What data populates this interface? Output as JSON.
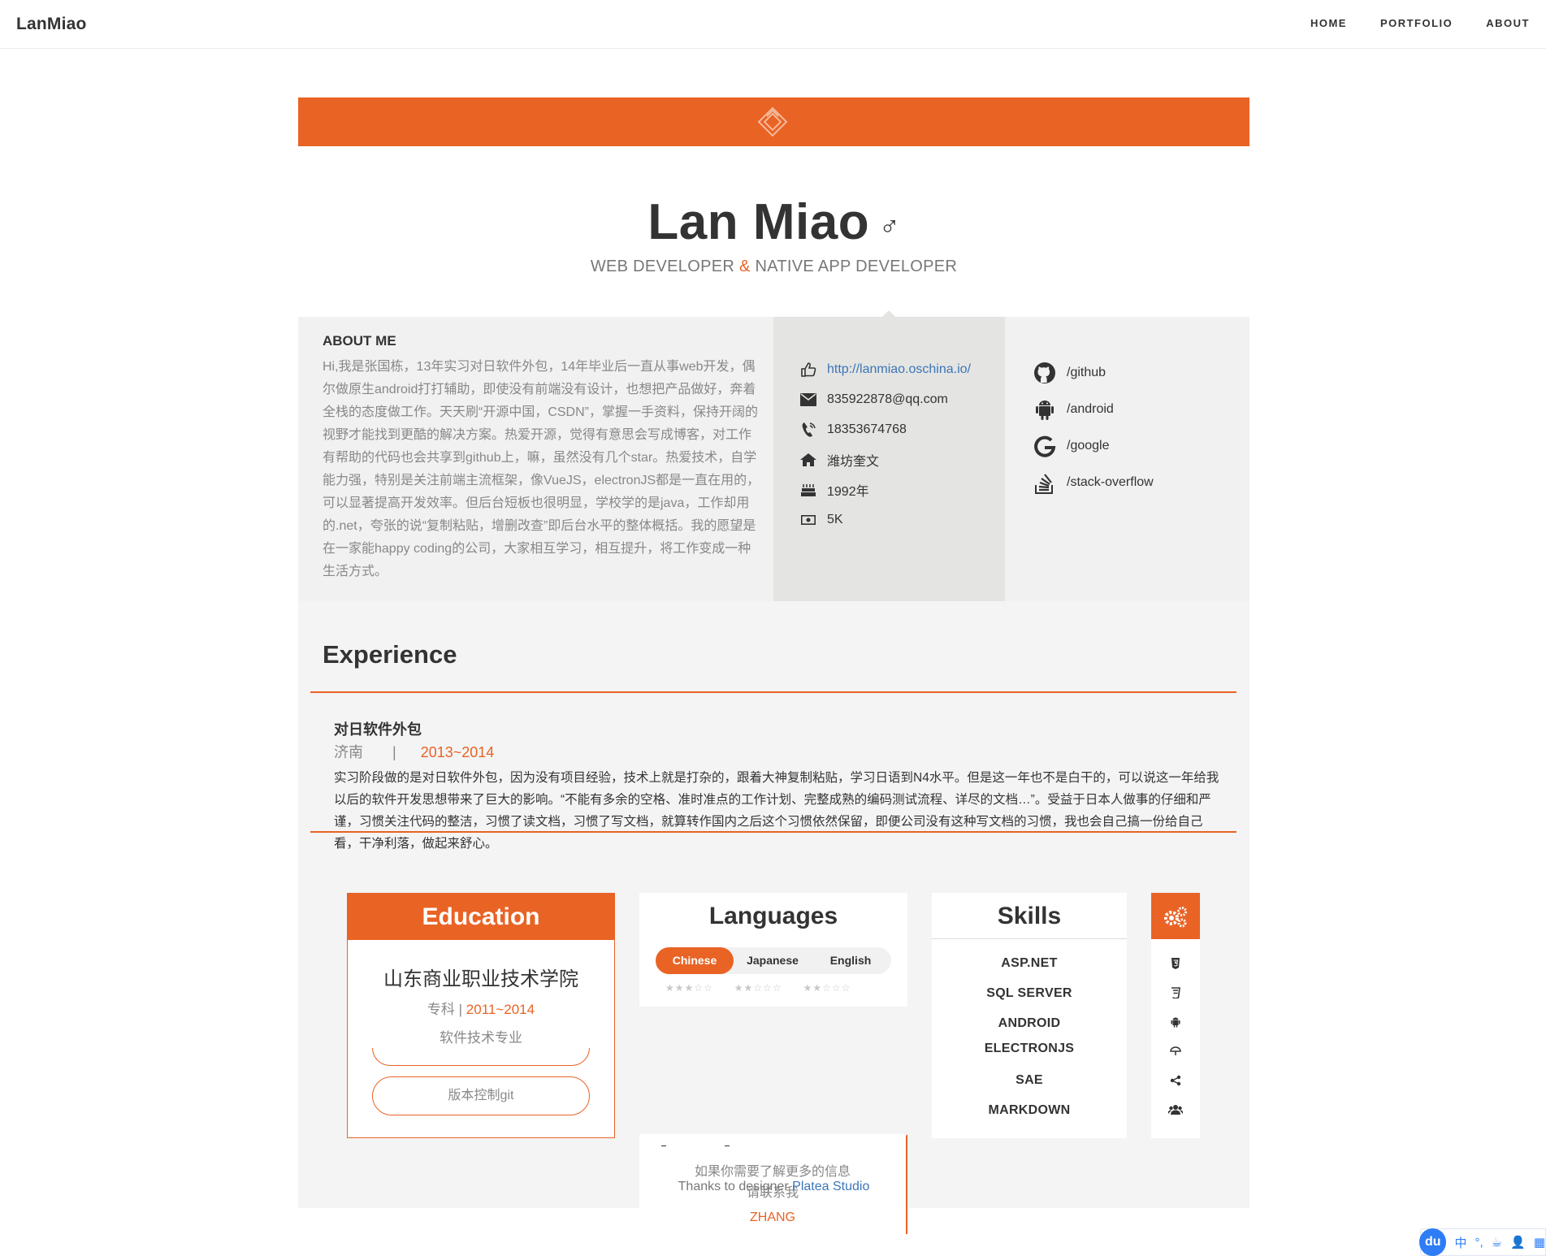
{
  "nav": {
    "brand": "LanMiao",
    "links": [
      "HOME",
      "PORTFOLIO",
      "ABOUT"
    ]
  },
  "profile": {
    "name": "Lan Miao",
    "gender_symbol": "♂",
    "subtitle_left": "WEB DEVELOPER ",
    "subtitle_amp": "&",
    "subtitle_right": " NATIVE APP DEVELOPER"
  },
  "about": {
    "heading": "ABOUT ME",
    "text": "Hi,我是张国栋，13年实习对日软件外包，14年毕业后一直从事web开发，偶尔做原生android打打辅助，即使没有前端没有设计，也想把产品做好，奔着全栈的态度做工作。天天刷“开源中国，CSDN”，掌握一手资料，保持开阔的视野才能找到更酷的解决方案。热爱开源，觉得有意思会写成博客，对工作有帮助的代码也会共享到github上，嘛，虽然没有几个star。热爱技术，自学能力强，特别是关注前端主流框架，像VueJS，electronJS都是一直在用的，可以显著提高开发效率。但后台短板也很明显，学校学的是java，工作却用的.net，夸张的说“复制粘贴，增删改查”即后台水平的整体概括。我的愿望是在一家能happy coding的公司，大家相互学习，相互提升，将工作变成一种生活方式。"
  },
  "contact": {
    "website": "http://lanmiao.oschina.io/",
    "email": "835922878@qq.com",
    "phone": "18353674768",
    "home": "潍坊奎文",
    "birth": "1992年",
    "salary": "5K"
  },
  "social": [
    {
      "icon": "github-icon",
      "label": "/github"
    },
    {
      "icon": "android-icon",
      "label": "/android"
    },
    {
      "icon": "google-icon",
      "label": "/google"
    },
    {
      "icon": "stack-overflow-icon",
      "label": "/stack-overflow"
    }
  ],
  "experience": {
    "heading": "Experience",
    "job": {
      "title": "对日软件外包",
      "city": "济南",
      "sep": "|",
      "years": "2013~2014",
      "desc": "实习阶段做的是对日软件外包，因为没有项目经验，技术上就是打杂的，跟着大神复制粘贴，学习日语到N4水平。但是这一年也不是白干的，可以说这一年给我以后的软件开发思想带来了巨大的影响。“不能有多余的空格、准时准点的工作计划、完整成熟的编码测试流程、详尽的文档…”。受益于日本人做事的仔细和严谨，习惯关注代码的整洁，习惯了读文档，习惯了写文档，就算转作国内之后这个习惯依然保留，即便公司没有这种写文档的习惯，我也会自己搞一份给自己看，干净利落，做起来舒心。"
    }
  },
  "education": {
    "heading": "Education",
    "school": "山东商业职业技术学院",
    "degree": "专科",
    "sep": " | ",
    "years": "2011~2014",
    "major": "软件技术专业",
    "pill": "版本控制git"
  },
  "languages": {
    "heading": "Languages",
    "tabs": [
      "Chinese",
      "Japanese",
      "English"
    ],
    "active": "Chinese",
    "ratings": [
      3,
      2,
      2
    ]
  },
  "contact_note": {
    "line1": "如果你需要了解更多的信息",
    "line2": "请联系我",
    "name": "ZHANG"
  },
  "skills": {
    "heading": "Skills",
    "items": [
      "ASP.NET",
      "SQL SERVER",
      "ANDROID",
      "ELECTRONJS",
      "SAE",
      "MARKDOWN"
    ]
  },
  "skill_icons": [
    "html5-icon",
    "css3-icon",
    "android-icon",
    "umbrella-icon",
    "share-icon",
    "users-icon"
  ],
  "footer": {
    "text": "Thanks to designer ",
    "link": "Platea Studio"
  },
  "ime": {
    "logo": "du",
    "items": [
      "中",
      "°,",
      "☕",
      "👤",
      "▦"
    ]
  },
  "colors": {
    "accent": "#e96325",
    "link": "#3b76b8"
  }
}
